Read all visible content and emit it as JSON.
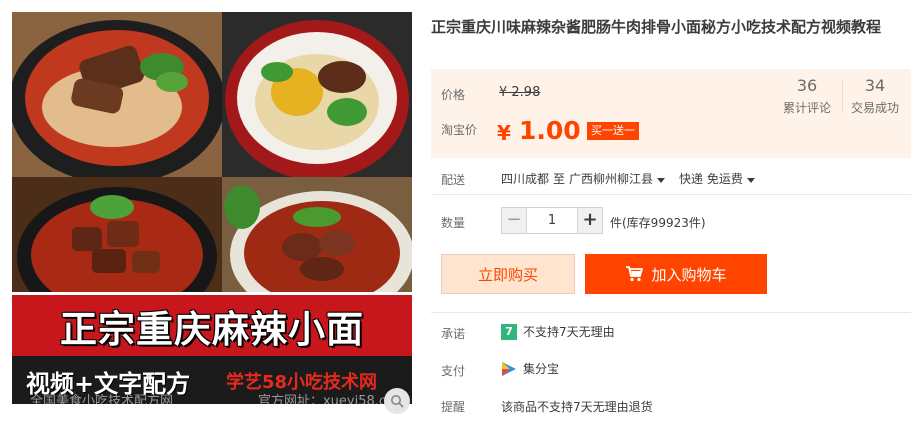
{
  "product": {
    "title": "正宗重庆川味麻辣杂酱肥肠牛肉排骨小面秘方小吃技术配方视频教程",
    "image": {
      "banner_main": "正宗重庆麻辣小面",
      "banner_left": "视频+文字配方",
      "banner_right": "学艺58小吃技术网",
      "footer_left": "全国美食小吃技术配方网",
      "footer_right": "官方网址：xueyi58.co"
    }
  },
  "price": {
    "label": "价格",
    "original": "¥ 2.98",
    "taobao_label": "淘宝价",
    "currency": "¥",
    "current": "1.00",
    "promo_tag": "买一送一",
    "accent_color": "#ff4400"
  },
  "stats": {
    "reviews_count": "36",
    "reviews_label": "累计评论",
    "deals_count": "34",
    "deals_label": "交易成功"
  },
  "shipping": {
    "label": "配送",
    "from": "四川成都",
    "to_word": "至",
    "destination": "广西柳州柳江县",
    "method": "快递 免运费"
  },
  "quantity": {
    "label": "数量",
    "minus": "−",
    "value": "1",
    "plus": "+",
    "stock": "件(库存99923件)"
  },
  "actions": {
    "buy_now": "立即购买",
    "add_to_cart": "加入购物车"
  },
  "services": {
    "promise_label": "承诺",
    "promise_badge": "7",
    "promise_text": "不支持7天无理由",
    "payment_label": "支付",
    "payment_text": "集分宝",
    "reminder_label": "提醒",
    "reminder_text": "该商品不支持7天无理由退货"
  }
}
